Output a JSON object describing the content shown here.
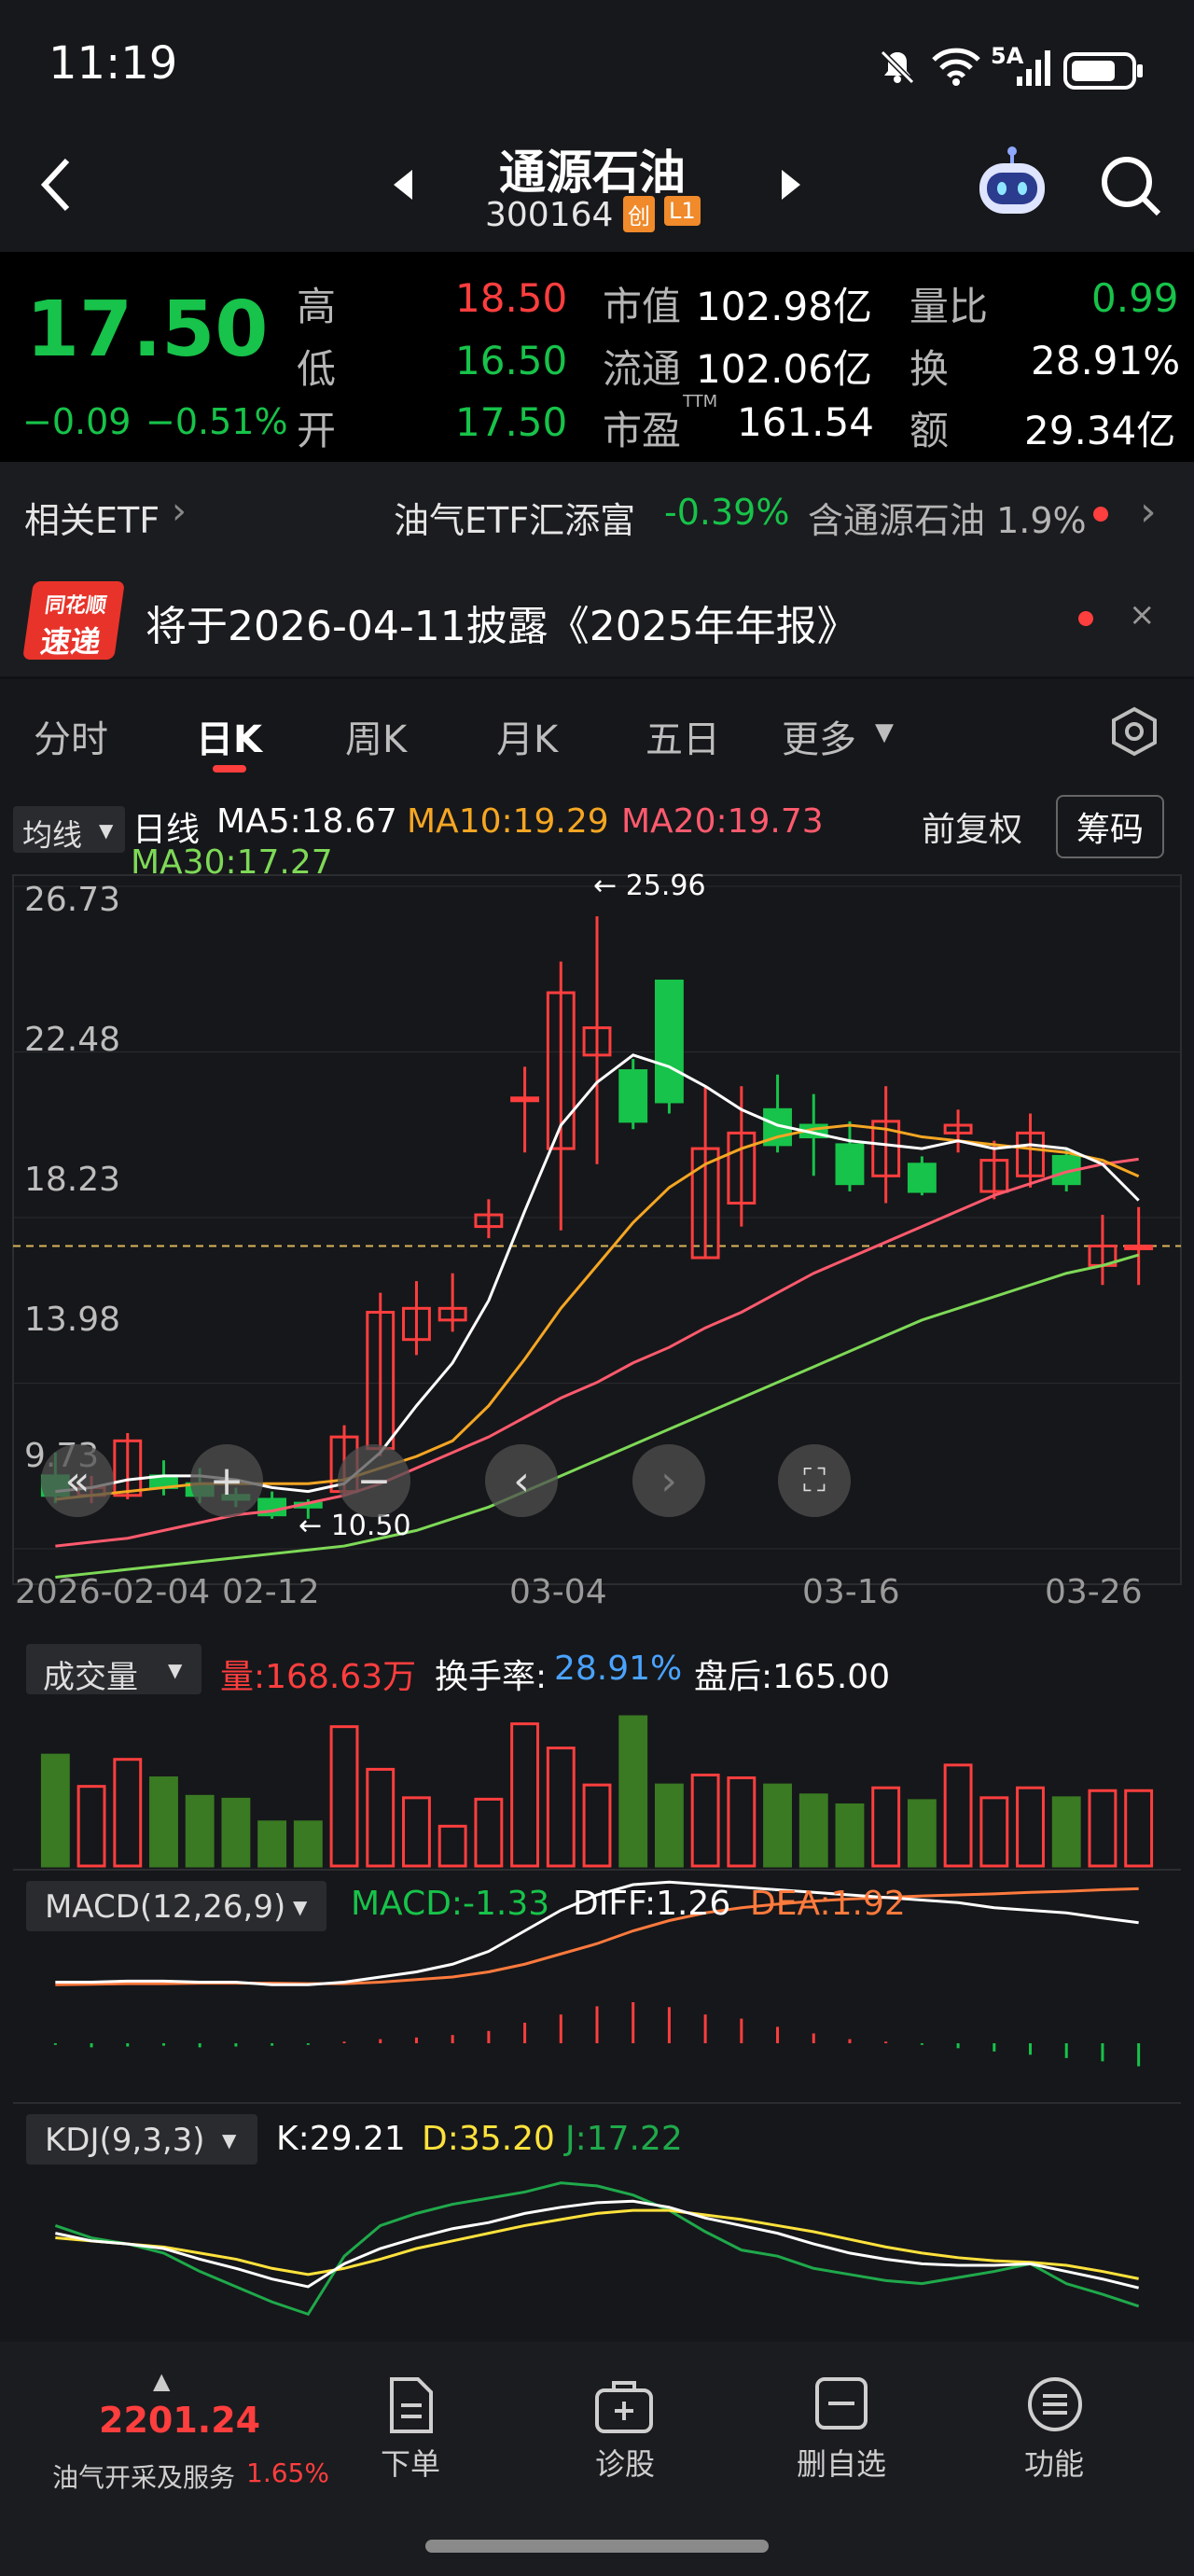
{
  "status": {
    "time": "11:19",
    "network": "5A"
  },
  "header": {
    "name": "通源石油",
    "code": "300164",
    "badge1": "创",
    "badge2": "L1"
  },
  "quote": {
    "price": "17.50",
    "change": "−0.09",
    "change_pct": "−0.51%",
    "high_label": "高",
    "high": "18.50",
    "low_label": "低",
    "low": "16.50",
    "open_label": "开",
    "open": "17.50",
    "mktcap_label": "市值",
    "mktcap": "102.98亿",
    "float_label": "流通",
    "float": "102.06亿",
    "pe_label": "市盈",
    "pe_sup": "TTM",
    "pe": "161.54",
    "volratio_label": "量比",
    "volratio": "0.99",
    "turnover_label": "换",
    "turnover": "28.91%",
    "amount_label": "额",
    "amount": "29.34亿"
  },
  "etf": {
    "label": "相关ETF",
    "name": "油气ETF汇添富",
    "change": "-0.39%",
    "holding": "含通源石油 1.9%"
  },
  "notice": {
    "logo_top": "同花顺",
    "logo_bottom": "速递",
    "text": "将于2026-04-11披露《2025年年报》"
  },
  "tabs": [
    "分时",
    "日K",
    "周K",
    "月K",
    "五日",
    "更多"
  ],
  "kline": {
    "type_label": "均线",
    "day_label": "日线",
    "ma5": "MA5:18.67",
    "ma10": "MA10:19.29",
    "ma20": "MA20:19.73",
    "ma30": "MA30:17.27",
    "adjust": "前复权",
    "chips": "筹码",
    "y_ticks": [
      "26.73",
      "22.48",
      "18.23",
      "13.98",
      "9.73"
    ],
    "max_label": "25.96",
    "min_label": "10.50",
    "x_ticks": [
      "2026-02-04",
      "02-12",
      "03-04",
      "03-16",
      "03-26"
    ]
  },
  "volume": {
    "label": "成交量",
    "vol": "量:168.63万",
    "turn_label": "换手率:",
    "turn": "28.91%",
    "after": "盘后:165.00"
  },
  "macd": {
    "label": "MACD(12,26,9)",
    "macd": "MACD:-1.33",
    "diff": "DIFF:1.26",
    "dea": "DEA:1.92"
  },
  "kdj": {
    "label": "KDJ(9,3,3)",
    "k": "K:29.21",
    "d": "D:35.20",
    "j": "J:17.22"
  },
  "bottom": {
    "index_value": "2201.24",
    "index_name": "油气开采及服务",
    "index_pct": "1.65%",
    "order": "下单",
    "diagnose": "诊股",
    "remove": "删自选",
    "function": "功能"
  },
  "colors": {
    "up": "#ff3e3e",
    "down": "#17c34a",
    "ma5": "#ffffff",
    "ma10": "#f5a623",
    "ma20": "#ff5a6e",
    "ma30": "#7ed957"
  },
  "chart_data": {
    "type": "candlestick",
    "candles": [
      {
        "o": 11.6,
        "c": 11.1,
        "h": 12.2,
        "l": 10.9
      },
      {
        "o": 11.1,
        "c": 11.3,
        "h": 11.6,
        "l": 10.9
      },
      {
        "o": 11.1,
        "c": 12.5,
        "h": 12.7,
        "l": 11.0
      },
      {
        "o": 11.6,
        "c": 11.3,
        "h": 12.0,
        "l": 11.1
      },
      {
        "o": 11.4,
        "c": 11.1,
        "h": 11.8,
        "l": 10.9
      },
      {
        "o": 11.1,
        "c": 11.0,
        "h": 11.3,
        "l": 10.8
      },
      {
        "o": 11.0,
        "c": 10.6,
        "h": 11.2,
        "l": 10.5
      },
      {
        "o": 10.9,
        "c": 10.8,
        "h": 11.0,
        "l": 10.5
      },
      {
        "o": 11.2,
        "c": 12.6,
        "h": 12.9,
        "l": 11.1
      },
      {
        "o": 12.3,
        "c": 15.8,
        "h": 16.3,
        "l": 12.1
      },
      {
        "o": 15.1,
        "c": 15.9,
        "h": 16.6,
        "l": 14.7
      },
      {
        "o": 15.6,
        "c": 15.9,
        "h": 16.8,
        "l": 15.3
      },
      {
        "o": 18.0,
        "c": 18.3,
        "h": 18.7,
        "l": 17.7
      },
      {
        "o": 21.3,
        "c": 21.3,
        "h": 22.1,
        "l": 19.9
      },
      {
        "o": 20.0,
        "c": 24.0,
        "h": 24.8,
        "l": 17.9
      },
      {
        "o": 22.4,
        "c": 23.1,
        "h": 25.96,
        "l": 19.6
      },
      {
        "o": 22.0,
        "c": 20.7,
        "h": 22.3,
        "l": 20.5
      },
      {
        "o": 24.3,
        "c": 21.2,
        "h": 24.3,
        "l": 20.9
      },
      {
        "o": 17.2,
        "c": 20.0,
        "h": 21.6,
        "l": 17.2
      },
      {
        "o": 18.6,
        "c": 20.4,
        "h": 21.6,
        "l": 18.0
      },
      {
        "o": 21.0,
        "c": 20.1,
        "h": 21.9,
        "l": 19.9
      },
      {
        "o": 20.6,
        "c": 20.3,
        "h": 21.4,
        "l": 19.3
      },
      {
        "o": 20.1,
        "c": 19.1,
        "h": 20.7,
        "l": 18.9
      },
      {
        "o": 19.3,
        "c": 20.7,
        "h": 21.6,
        "l": 18.6
      },
      {
        "o": 19.6,
        "c": 18.9,
        "h": 19.8,
        "l": 18.8
      },
      {
        "o": 20.4,
        "c": 20.6,
        "h": 21.0,
        "l": 19.9
      },
      {
        "o": 18.9,
        "c": 19.7,
        "h": 20.2,
        "l": 18.7
      },
      {
        "o": 19.3,
        "c": 20.4,
        "h": 20.9,
        "l": 19.0
      },
      {
        "o": 19.8,
        "c": 19.1,
        "h": 20.0,
        "l": 18.9
      },
      {
        "o": 17.0,
        "c": 17.5,
        "h": 18.3,
        "l": 16.5
      },
      {
        "o": 17.5,
        "c": 17.5,
        "h": 18.5,
        "l": 16.5
      }
    ],
    "ma5": [
      11.2,
      11.3,
      11.5,
      11.6,
      11.6,
      11.5,
      11.3,
      11.2,
      11.4,
      12.2,
      13.4,
      14.5,
      16.1,
      18.4,
      20.6,
      21.7,
      22.4,
      22.1,
      21.6,
      21.0,
      20.6,
      20.4,
      20.2,
      20.1,
      20.0,
      20.2,
      20.0,
      20.1,
      20.0,
      19.6,
      18.67
    ],
    "ma10": [
      11.0,
      11.1,
      11.2,
      11.3,
      11.4,
      11.4,
      11.4,
      11.4,
      11.5,
      11.8,
      12.1,
      12.5,
      13.4,
      14.6,
      15.9,
      17.0,
      18.1,
      19.0,
      19.6,
      20.0,
      20.3,
      20.5,
      20.6,
      20.5,
      20.3,
      20.2,
      20.1,
      20.0,
      19.9,
      19.7,
      19.29
    ],
    "ma20": [
      9.8,
      9.9,
      10.0,
      10.2,
      10.4,
      10.6,
      10.7,
      10.9,
      11.1,
      11.4,
      11.8,
      12.2,
      12.6,
      13.1,
      13.6,
      14.0,
      14.5,
      14.9,
      15.4,
      15.8,
      16.3,
      16.8,
      17.2,
      17.6,
      18.0,
      18.4,
      18.8,
      19.1,
      19.4,
      19.6,
      19.73
    ],
    "ma30": [
      9.0,
      9.1,
      9.2,
      9.3,
      9.4,
      9.5,
      9.6,
      9.7,
      9.8,
      10.0,
      10.2,
      10.5,
      10.8,
      11.2,
      11.6,
      12.0,
      12.4,
      12.8,
      13.2,
      13.6,
      14.0,
      14.4,
      14.8,
      15.2,
      15.6,
      15.9,
      16.2,
      16.5,
      16.8,
      17.0,
      17.27
    ],
    "volume": [
      0.78,
      0.56,
      0.75,
      0.62,
      0.49,
      0.47,
      0.31,
      0.31,
      0.98,
      0.68,
      0.48,
      0.28,
      0.47,
      1.0,
      0.83,
      0.57,
      1.05,
      0.57,
      0.64,
      0.62,
      0.57,
      0.5,
      0.43,
      0.55,
      0.46,
      0.71,
      0.48,
      0.55,
      0.48,
      0.53,
      0.53
    ],
    "macd_hist": [
      -0.02,
      -0.05,
      -0.04,
      -0.03,
      -0.05,
      -0.04,
      -0.03,
      -0.02,
      0.02,
      0.05,
      0.07,
      0.1,
      0.15,
      0.25,
      0.35,
      0.45,
      0.5,
      0.44,
      0.35,
      0.3,
      0.2,
      0.12,
      0.05,
      0.02,
      -0.02,
      -0.06,
      -0.1,
      -0.14,
      -0.18,
      -0.22,
      -0.28
    ],
    "diff": [
      0.1,
      0.1,
      0.12,
      0.12,
      0.1,
      0.1,
      0.05,
      0.05,
      0.1,
      0.2,
      0.3,
      0.45,
      0.7,
      1.1,
      1.5,
      1.8,
      2.0,
      2.05,
      2.0,
      1.95,
      1.9,
      1.85,
      1.8,
      1.75,
      1.7,
      1.65,
      1.55,
      1.5,
      1.45,
      1.35,
      1.26
    ],
    "dea": [
      0.05,
      0.06,
      0.07,
      0.07,
      0.08,
      0.08,
      0.08,
      0.07,
      0.07,
      0.1,
      0.15,
      0.2,
      0.3,
      0.45,
      0.65,
      0.85,
      1.1,
      1.3,
      1.45,
      1.55,
      1.62,
      1.68,
      1.72,
      1.75,
      1.78,
      1.8,
      1.82,
      1.85,
      1.87,
      1.9,
      1.92
    ],
    "k": [
      65,
      60,
      58,
      55,
      48,
      42,
      35,
      30,
      45,
      55,
      62,
      68,
      72,
      78,
      82,
      85,
      86,
      82,
      75,
      70,
      65,
      58,
      52,
      48,
      45,
      44,
      44,
      45,
      40,
      35,
      29.21
    ],
    "d": [
      62,
      60,
      58,
      56,
      52,
      48,
      42,
      38,
      42,
      48,
      55,
      60,
      65,
      70,
      74,
      78,
      80,
      80,
      77,
      74,
      70,
      66,
      61,
      56,
      52,
      49,
      47,
      46,
      44,
      40,
      35.2
    ],
    "j": [
      70,
      62,
      58,
      52,
      40,
      30,
      20,
      12,
      50,
      70,
      78,
      84,
      88,
      92,
      98,
      96,
      90,
      80,
      66,
      54,
      50,
      42,
      38,
      34,
      32,
      36,
      40,
      45,
      32,
      25,
      17.22
    ]
  }
}
